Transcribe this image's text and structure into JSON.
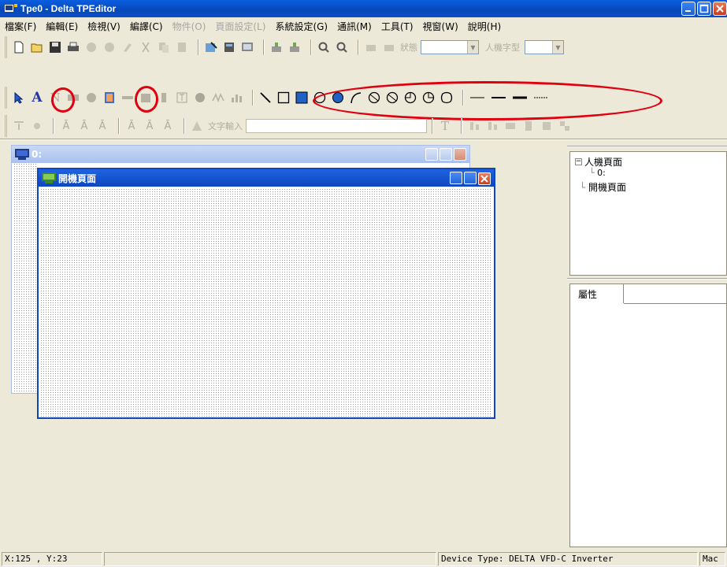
{
  "window": {
    "title": "Tpe0 - Delta TPEditor"
  },
  "menu": [
    {
      "label": "檔案(F)",
      "enabled": true
    },
    {
      "label": "編輯(E)",
      "enabled": true
    },
    {
      "label": "檢視(V)",
      "enabled": true
    },
    {
      "label": "編譯(C)",
      "enabled": true
    },
    {
      "label": "物件(O)",
      "enabled": false
    },
    {
      "label": "頁面設定(L)",
      "enabled": false
    },
    {
      "label": "系統設定(G)",
      "enabled": true
    },
    {
      "label": "通訊(M)",
      "enabled": true
    },
    {
      "label": "工具(T)",
      "enabled": true
    },
    {
      "label": "視窗(W)",
      "enabled": true
    },
    {
      "label": "說明(H)",
      "enabled": true
    }
  ],
  "toolbar1": {
    "state_label": "狀態",
    "hmi_type_label": "人機字型"
  },
  "toolbar3": {
    "text_input_label": "文字輸入",
    "text_icon": "T"
  },
  "mdi": {
    "back_window_title": "0:",
    "front_window_title": "開機頁面"
  },
  "tree": {
    "root": "人機頁面",
    "child": "0:",
    "sibling": "開機頁面"
  },
  "properties": {
    "tab_label": "屬性"
  },
  "statusbar": {
    "coords": "X:125 , Y:23",
    "device": "Device Type: DELTA VFD-C Inverter",
    "machine": "Mac"
  },
  "colors": {
    "highlight_ring": "#e00010",
    "titlebar": "#0a5fe0"
  }
}
